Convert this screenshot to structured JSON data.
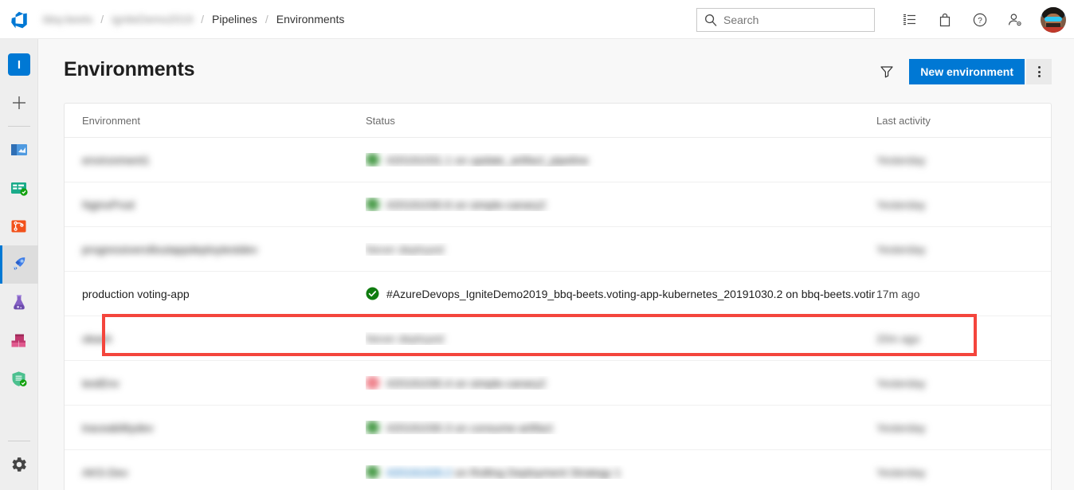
{
  "topbar": {
    "logo_icon": "azure-devops-logo",
    "breadcrumb": [
      {
        "label": "bbq-beets",
        "blurred": true
      },
      {
        "label": "igniteDemo2019",
        "blurred": true
      },
      {
        "label": "Pipelines",
        "blurred": false
      },
      {
        "label": "Environments",
        "blurred": false
      }
    ],
    "separator": "/",
    "search": {
      "placeholder": "Search",
      "value": "",
      "icon": "search-icon"
    },
    "icons": [
      {
        "name": "task-list-icon",
        "glyph": "list"
      },
      {
        "name": "marketplace-bag-icon",
        "glyph": "bag"
      },
      {
        "name": "help-icon",
        "glyph": "question"
      },
      {
        "name": "user-settings-icon",
        "glyph": "person-gear"
      }
    ],
    "avatar_name": "user-avatar"
  },
  "rail": {
    "project_initial": "I",
    "items": [
      {
        "name": "sidebar-item-project-avatar",
        "label": "I"
      },
      {
        "name": "sidebar-item-new",
        "label": "+"
      },
      {
        "name": "sidebar-item-overview",
        "label": "Overview"
      },
      {
        "name": "sidebar-item-boards",
        "label": "Boards"
      },
      {
        "name": "sidebar-item-repos",
        "label": "Repos"
      },
      {
        "name": "sidebar-item-pipelines",
        "label": "Pipelines",
        "selected": true
      },
      {
        "name": "sidebar-item-test-plans",
        "label": "Test Plans"
      },
      {
        "name": "sidebar-item-artifacts",
        "label": "Artifacts"
      },
      {
        "name": "sidebar-item-security",
        "label": "Security"
      },
      {
        "name": "sidebar-item-settings",
        "label": "Project settings"
      }
    ]
  },
  "page": {
    "title": "Environments",
    "filter_icon": "filter-funnel-icon",
    "new_environment_label": "New environment",
    "more_actions_icon": "more-actions-icon"
  },
  "table": {
    "columns": [
      "Environment",
      "Status",
      "Last activity"
    ],
    "rows": [
      {
        "environment": "environment1",
        "status_icon": "success",
        "status": "#20191031.1 on update_artifact_pipeline",
        "last_activity": "Yesterday",
        "blurred": true,
        "highlighted": false
      },
      {
        "environment": "NginxProd",
        "status_icon": "success",
        "status": "#20191030.6 on simple-canary2",
        "last_activity": "Yesterday",
        "blurred": true,
        "highlighted": false
      },
      {
        "environment": "progressiverolloutappdeploytestdev",
        "status_icon": "none",
        "status": "Never deployed",
        "last_activity": "Yesterday",
        "blurred": true,
        "highlighted": false
      },
      {
        "environment": "production voting-app",
        "status_icon": "success",
        "status": "#AzureDevops_IgniteDemo2019_bbq-beets.voting-app-kubernetes_20191030.2 on bbq-beets.votir",
        "last_activity": "17m ago",
        "blurred": false,
        "highlighted": true
      },
      {
        "environment": "okash",
        "status_icon": "none",
        "status": "Never deployed",
        "last_activity": "20m ago",
        "blurred": true,
        "highlighted": false
      },
      {
        "environment": "testEnv",
        "status_icon": "failed",
        "status": "#20191030.4 on simple-canary2",
        "last_activity": "Yesterday",
        "blurred": true,
        "highlighted": false
      },
      {
        "environment": "traceabilitydev",
        "status_icon": "success",
        "status": "#20191030.3 on consume-artifact",
        "last_activity": "Yesterday",
        "blurred": true,
        "highlighted": false
      },
      {
        "environment": "AKS-Dev",
        "status_icon": "success",
        "status": "#20191029.2 on Rolling Deployment Strategy 1",
        "status_link": "#20191029.2",
        "last_activity": "Yesterday",
        "blurred": true,
        "highlighted": false
      }
    ]
  },
  "colors": {
    "accent": "#0078d4",
    "success": "#107c10",
    "failed": "#e74856",
    "highlight_border": "#f4453c",
    "link": "#0067b8"
  }
}
